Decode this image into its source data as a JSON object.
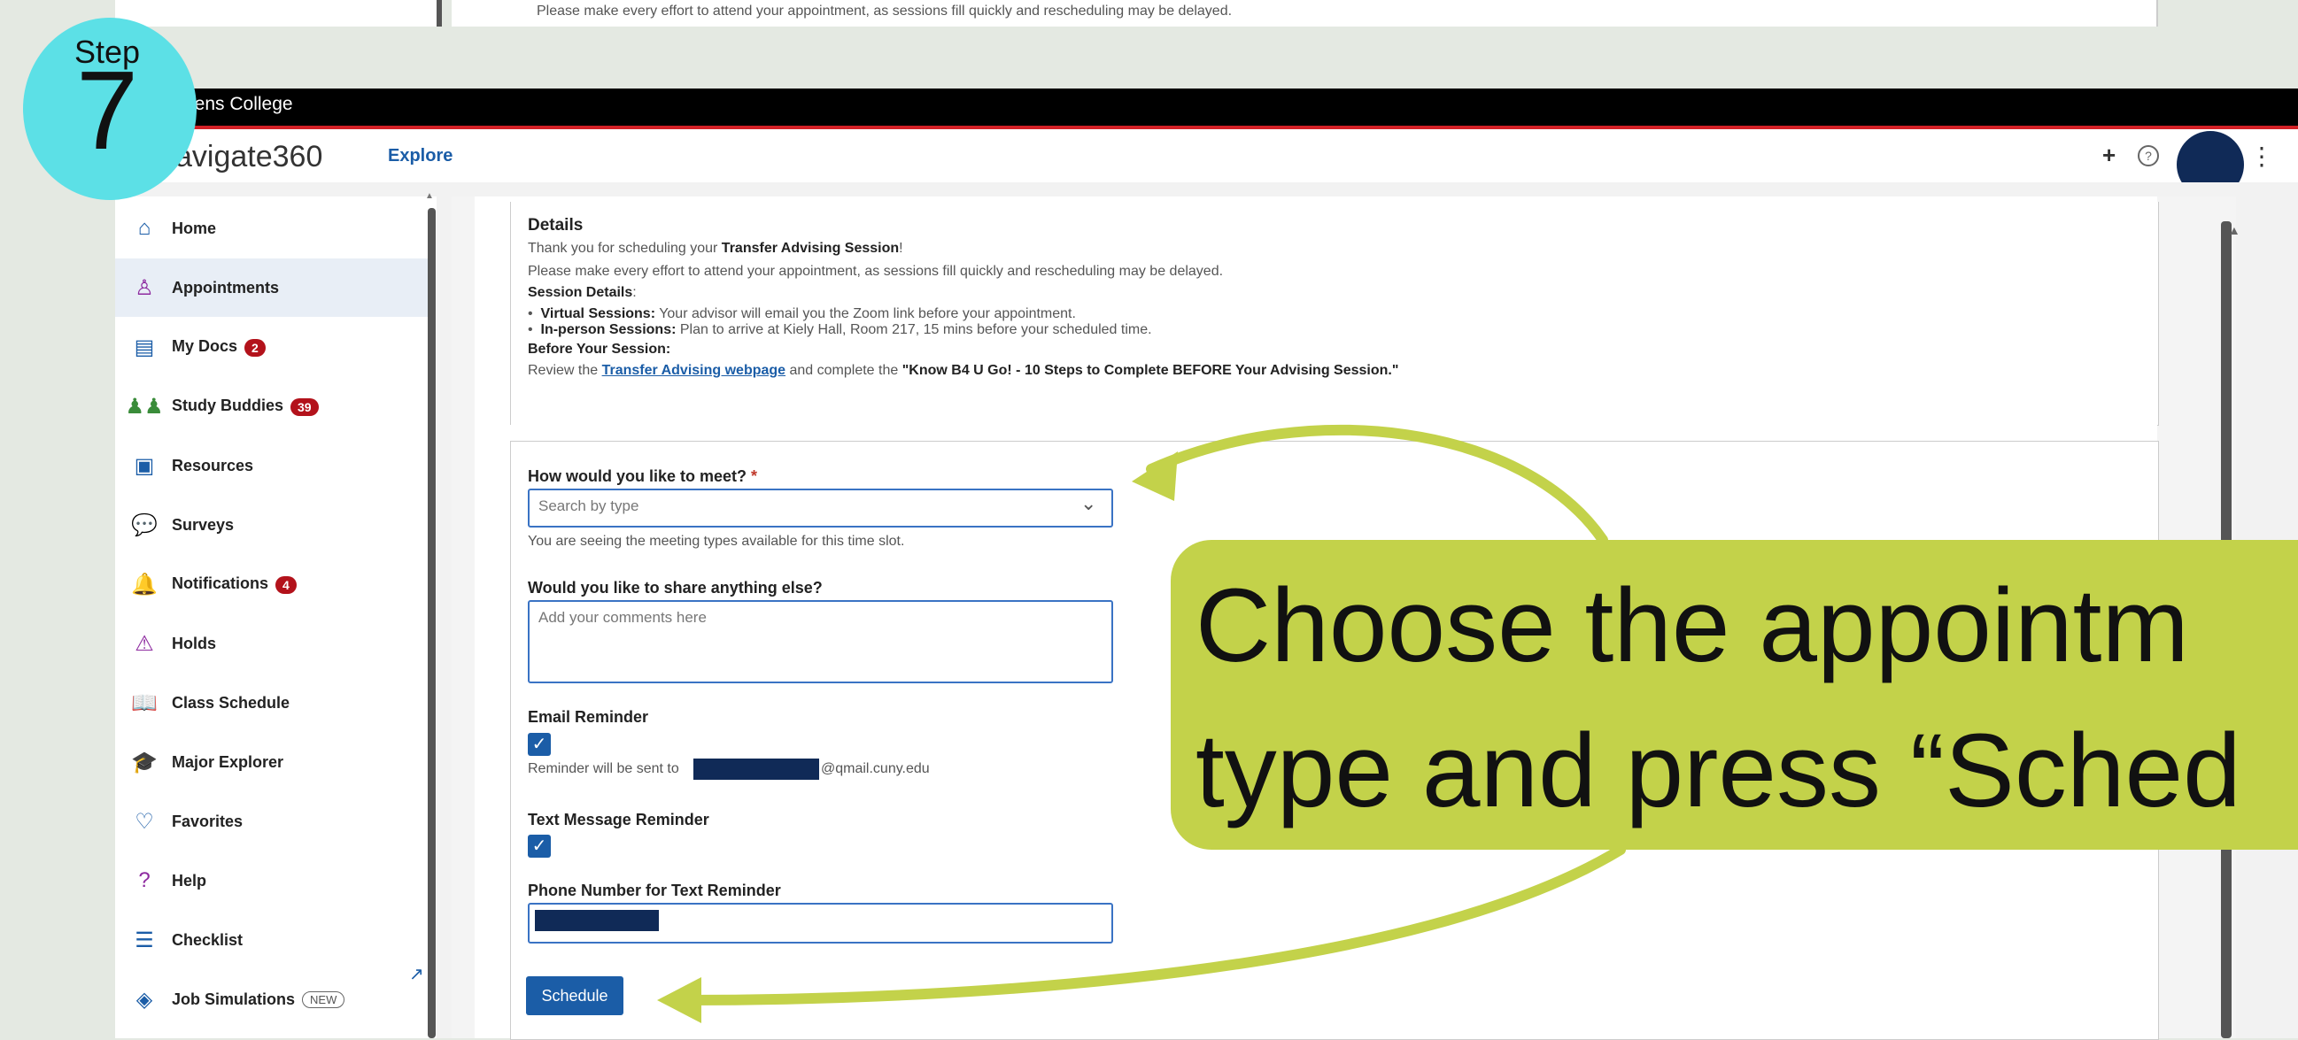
{
  "background_screen": {
    "notice": "Please make every effort to attend your appointment, as sessions fill quickly and rescheduling may be delayed."
  },
  "institution": {
    "name": "eens College"
  },
  "header": {
    "app_title": "avigate360",
    "explore_label": "Explore",
    "plus_icon": "+",
    "help_icon": "?"
  },
  "sidebar": {
    "items": [
      {
        "label": "Home",
        "icon": "home-icon",
        "glyph": "⌂"
      },
      {
        "label": "Appointments",
        "icon": "person-icon",
        "glyph": "♙",
        "active": true
      },
      {
        "label": "My Docs",
        "icon": "document-icon",
        "glyph": "▤",
        "badge": "2"
      },
      {
        "label": "Study Buddies",
        "icon": "people-icon",
        "glyph": "♟♟",
        "badge": "39"
      },
      {
        "label": "Resources",
        "icon": "resources-icon",
        "glyph": "▣"
      },
      {
        "label": "Surveys",
        "icon": "chat-icon",
        "glyph": "💬"
      },
      {
        "label": "Notifications",
        "icon": "bell-icon",
        "glyph": "🔔",
        "badge": "4"
      },
      {
        "label": "Holds",
        "icon": "warning-icon",
        "glyph": "⚠"
      },
      {
        "label": "Class Schedule",
        "icon": "book-icon",
        "glyph": "📖"
      },
      {
        "label": "Major Explorer",
        "icon": "graduation-cap-icon",
        "glyph": "🎓"
      },
      {
        "label": "Favorites",
        "icon": "heart-icon",
        "glyph": "♡"
      },
      {
        "label": "Help",
        "icon": "help-icon",
        "glyph": "?"
      },
      {
        "label": "Checklist",
        "icon": "checklist-icon",
        "glyph": "☰"
      },
      {
        "label": "Job Simulations",
        "icon": "job-sim-icon",
        "glyph": "◈",
        "new": "NEW"
      }
    ],
    "expand_icon": "↗"
  },
  "details": {
    "heading": "Details",
    "thanks_prefix": "Thank you for scheduling your ",
    "thanks_bold": "Transfer Advising Session",
    "thanks_suffix": "!",
    "notice": "Please make every effort to attend your appointment, as sessions fill quickly and rescheduling may be delayed.",
    "session_details_label": "Session Details",
    "session_details_colon": ":",
    "virtual_label": "Virtual Sessions:",
    "virtual_text": " Your advisor will email you the Zoom link before your appointment.",
    "inperson_label": "In-person Sessions:",
    "inperson_text": " Plan to arrive at Kiely Hall, Room 217, 15 mins before your scheduled time.",
    "before_label": "Before Your Session:",
    "review_prefix": "Review the ",
    "review_link": "Transfer Advising webpage",
    "review_middle": " and complete the ",
    "review_bold": "\"Know B4 U Go! - 10 Steps to Complete BEFORE Your Advising Session.\""
  },
  "form": {
    "meet_label": "How would you like to meet?",
    "required_mark": "*",
    "meet_placeholder": "Search by type",
    "meet_help": "You are seeing the meeting types available for this time slot.",
    "share_label": "Would you like to share anything else?",
    "share_placeholder": "Add your comments here",
    "email_label": "Email Reminder",
    "email_checked": true,
    "email_note_prefix": "Reminder will be sent to",
    "email_note_suffix": "@qmail.cuny.edu",
    "text_label": "Text Message Reminder",
    "text_checked": true,
    "phone_label": "Phone Number for Text Reminder",
    "schedule_label": "Schedule"
  },
  "step_badge": {
    "word": "Step",
    "number": "7"
  },
  "callout": {
    "line1": "Choose the appointm",
    "line2": "type and press “Sched"
  },
  "colors": {
    "accent": "#1b5da7",
    "badge_red": "#b3121b",
    "callout": "#c3d24a",
    "step_circle": "#5ce0e6",
    "navy": "#102a57"
  }
}
